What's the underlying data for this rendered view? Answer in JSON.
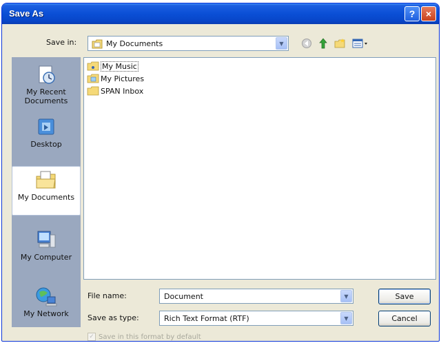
{
  "window": {
    "title": "Save As"
  },
  "titlebar": {
    "help_glyph": "?",
    "close_glyph": "×"
  },
  "toolbar": {
    "save_in_label": "Save in:",
    "save_in_value": "My Documents",
    "icons": [
      "back-icon",
      "up-folder-icon",
      "new-folder-icon",
      "views-menu-icon"
    ]
  },
  "places": [
    {
      "label": "My Recent Documents",
      "icon": "recent-documents-icon"
    },
    {
      "label": "Desktop",
      "icon": "desktop-icon"
    },
    {
      "label": "My Documents",
      "icon": "my-documents-icon",
      "selected": true
    },
    {
      "label": "My Computer",
      "icon": "my-computer-icon"
    },
    {
      "label": "My Network",
      "icon": "my-network-icon"
    }
  ],
  "files": [
    {
      "name": "My Music",
      "icon": "music-folder-icon"
    },
    {
      "name": "My Pictures",
      "icon": "pictures-folder-icon"
    },
    {
      "name": "SPAN Inbox",
      "icon": "folder-icon"
    }
  ],
  "form": {
    "file_name_label": "File name:",
    "file_name_value": "Document",
    "save_type_label": "Save as type:",
    "save_type_value": "Rich Text Format (RTF)",
    "default_format_label": "Save in this format by default"
  },
  "buttons": {
    "save": "Save",
    "cancel": "Cancel"
  },
  "colors": {
    "title_bar": "#0a4fd6",
    "dialog_bg": "#ece9d8",
    "places_bar": "#9aa8bf"
  }
}
